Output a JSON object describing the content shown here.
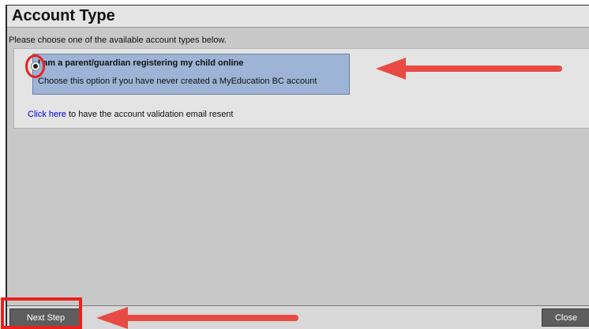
{
  "dialog": {
    "title": "Account Type",
    "instruction": "Please choose one of the available account types below."
  },
  "options": [
    {
      "title": "I am a parent/guardian registering my child online",
      "description": "Choose this option if you have never created a MyEducation BC account",
      "selected": true
    }
  ],
  "resend": {
    "link_text": "Click here",
    "rest_text": " to have the account validation email resent"
  },
  "footer": {
    "next_label": "Next Step",
    "close_label": "Close"
  },
  "annotations": {
    "highlight_color": "#e8211c",
    "arrow_color": "#e84b43"
  }
}
